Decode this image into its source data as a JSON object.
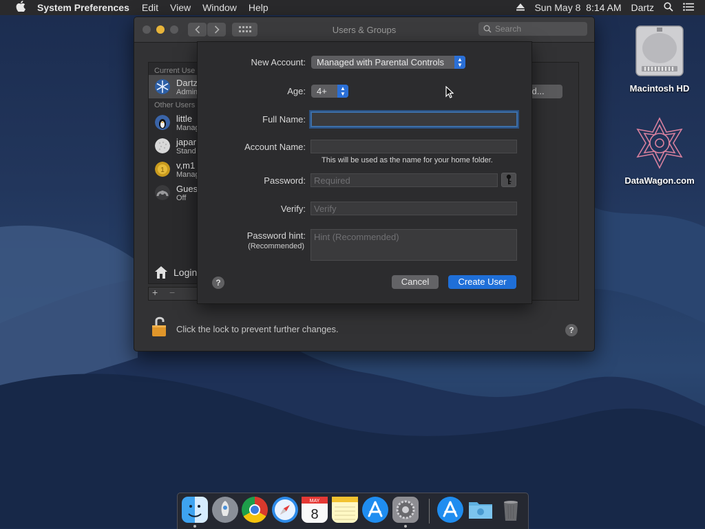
{
  "menubar": {
    "app_name": "System Preferences",
    "menus": [
      "Edit",
      "View",
      "Window",
      "Help"
    ],
    "datetime": "Sun May 8  8:14 AM",
    "user": "Dartz"
  },
  "desktop_icons": [
    {
      "label": "Macintosh HD",
      "icon": "hard-drive-icon"
    },
    {
      "label": "DataWagon.com",
      "icon": "datawagon-logo-icon"
    }
  ],
  "window": {
    "title": "Users & Groups",
    "search_placeholder": "Search",
    "current_users_header": "Current Use",
    "other_users_header": "Other Users",
    "current_user": {
      "name": "Dartz",
      "role": "Admin"
    },
    "other_users": [
      {
        "name": "little",
        "role": "Manag"
      },
      {
        "name": "japar",
        "role": "Stand"
      },
      {
        "name": "v,m1",
        "role": "Manag"
      },
      {
        "name": "Gues",
        "role": "Off"
      }
    ],
    "login_label": "Login",
    "password_button_label": "ord...",
    "lock_text": "Click the lock to prevent further changes."
  },
  "sheet": {
    "new_account_label": "New Account:",
    "new_account_value": "Managed with Parental Controls",
    "age_label": "Age:",
    "age_value": "4+",
    "full_name_label": "Full Name:",
    "full_name_value": "",
    "account_name_label": "Account Name:",
    "account_name_value": "",
    "account_name_note": "This will be used as the name for your home folder.",
    "password_label": "Password:",
    "password_placeholder": "Required",
    "verify_label": "Verify:",
    "verify_placeholder": "Verify",
    "hint_label": "Password hint:",
    "hint_sub": "(Recommended)",
    "hint_placeholder": "Hint (Recommended)",
    "cancel_label": "Cancel",
    "create_label": "Create User"
  },
  "colors": {
    "accent_blue": "#1f6fd8",
    "window_bg": "#323234",
    "sheet_bg": "#2c2c2e"
  }
}
